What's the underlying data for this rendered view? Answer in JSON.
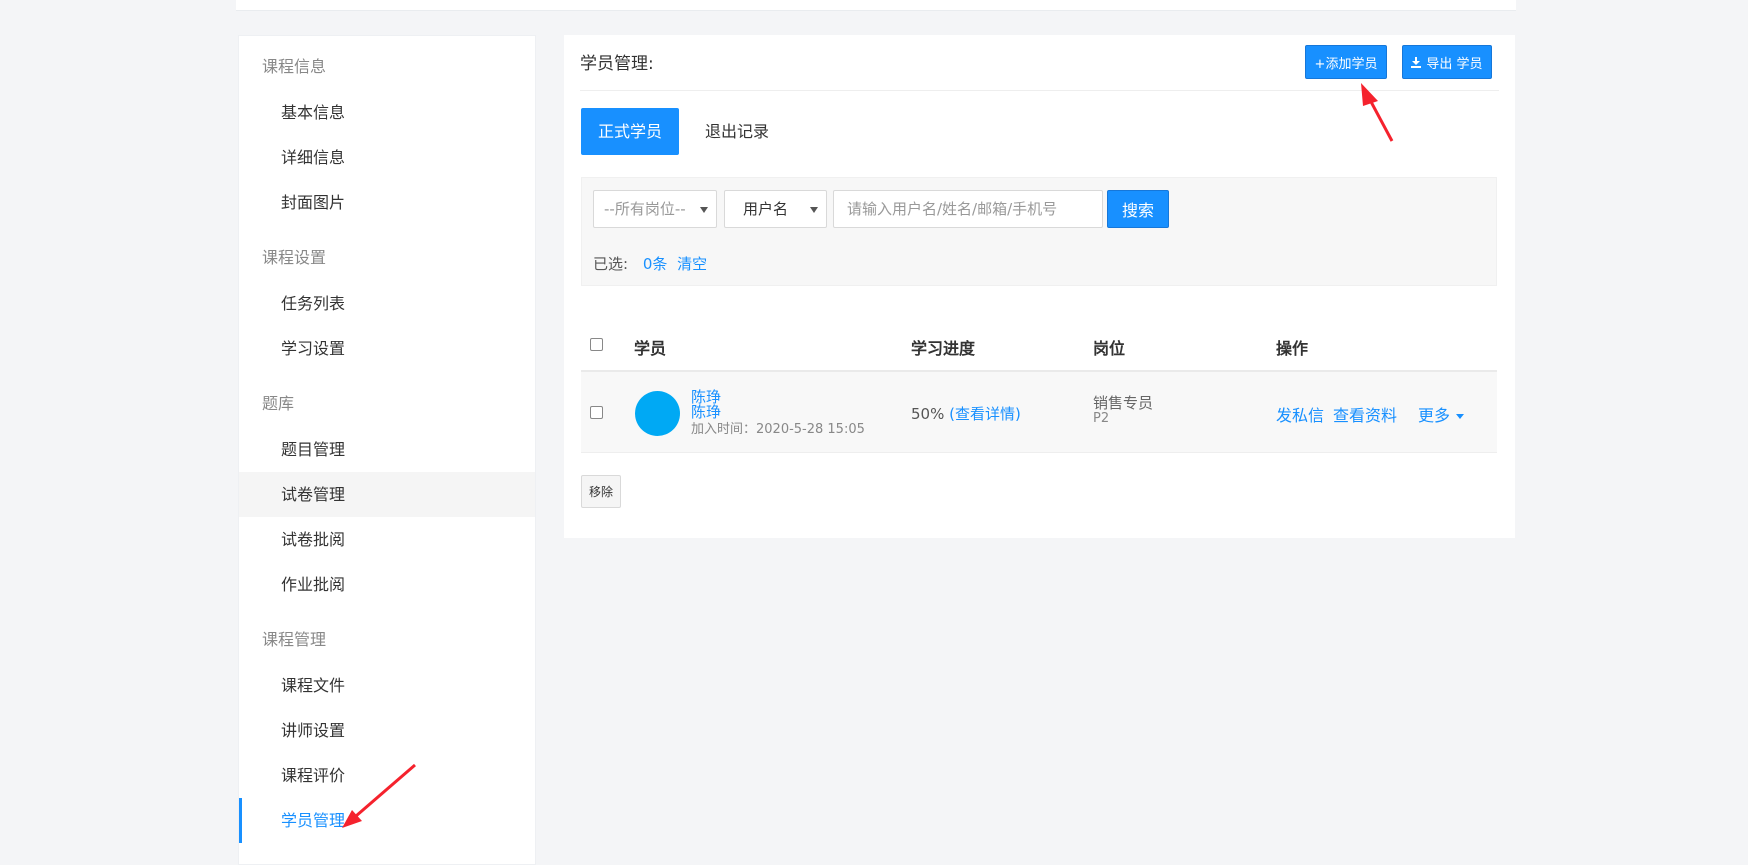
{
  "sidebar": {
    "groups": [
      {
        "label": "课程信息",
        "items": [
          "基本信息",
          "详细信息",
          "封面图片"
        ]
      },
      {
        "label": "课程设置",
        "items": [
          "任务列表",
          "学习设置"
        ]
      },
      {
        "label": "题库",
        "items": [
          "题目管理",
          "试卷管理",
          "试卷批阅",
          "作业批阅"
        ]
      },
      {
        "label": "课程管理",
        "items": [
          "课程文件",
          "讲师设置",
          "课程评价",
          "学员管理"
        ]
      }
    ],
    "hovered_item": "试卷管理",
    "active_item": "学员管理"
  },
  "main": {
    "title": "学员管理:",
    "add_button": "+添加学员",
    "export_button": "导出 学员",
    "tabs": [
      {
        "label": "正式学员",
        "active": true
      },
      {
        "label": "退出记录",
        "active": false
      }
    ],
    "filter": {
      "position_select": "--所有岗位--",
      "field_select": "用户名",
      "search_placeholder": "请输入用户名/姓名/邮箱/手机号",
      "search_button": "搜索",
      "selected_label": "已选:",
      "selected_count": "0条",
      "clear_label": "清空"
    },
    "table": {
      "headers": [
        "学员",
        "学习进度",
        "岗位",
        "操作"
      ],
      "rows": [
        {
          "name": "陈琤",
          "username": "陈琤",
          "join_time": "加入时间：2020-5-28 15:05",
          "progress": "50%",
          "progress_detail": "(查看详情)",
          "post": "销售专员",
          "post_level": "P2",
          "actions": [
            "发私信",
            "查看资料",
            "更多"
          ]
        }
      ]
    },
    "remove_button": "移除"
  },
  "colors": {
    "accent": "#1890ff",
    "avatar": "#00a9f4",
    "annotation_arrow": "#f5222d"
  }
}
